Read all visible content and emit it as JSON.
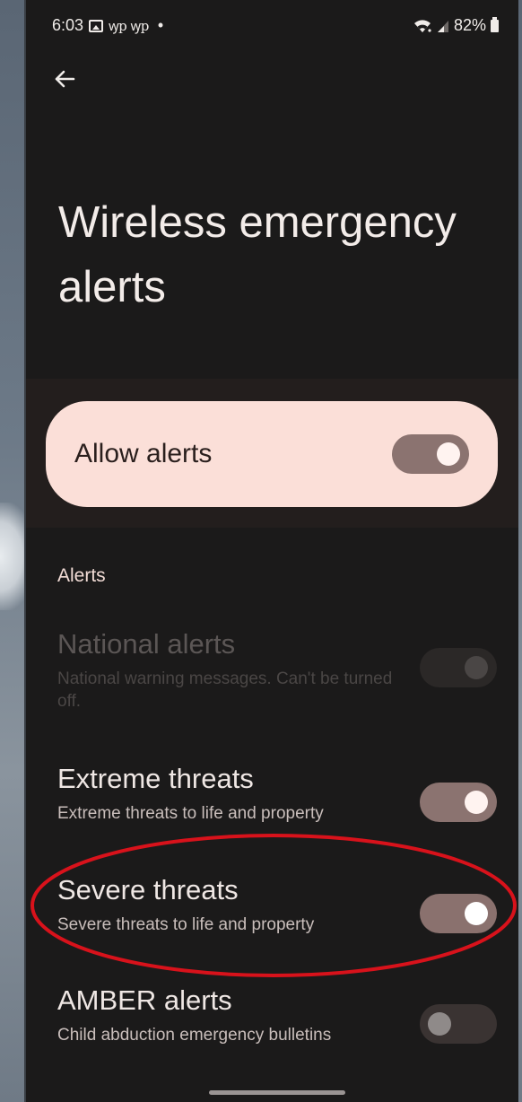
{
  "status_bar": {
    "time": "6:03",
    "notification_glyphs": "ꝡp ꝡp",
    "dot": "•",
    "battery": "82%"
  },
  "header": {
    "title": "Wireless emergency alerts"
  },
  "allow_alerts": {
    "label": "Allow alerts",
    "enabled": true
  },
  "alerts_section": {
    "header": "Alerts",
    "items": [
      {
        "title": "National alerts",
        "description": "National warning messages. Can't be turned off.",
        "state": "disabled-on"
      },
      {
        "title": "Extreme threats",
        "description": "Extreme threats to life and property",
        "state": "on"
      },
      {
        "title": "Severe threats",
        "description": "Severe threats to life and property",
        "state": "on"
      },
      {
        "title": "AMBER alerts",
        "description": "Child abduction emergency bulletins",
        "state": "off"
      }
    ]
  },
  "colors": {
    "screen_bg": "#1b1a1a",
    "card_bg": "#fbdfd8",
    "toggle_on": "#8b7370",
    "highlight_ring": "#d8121b"
  }
}
